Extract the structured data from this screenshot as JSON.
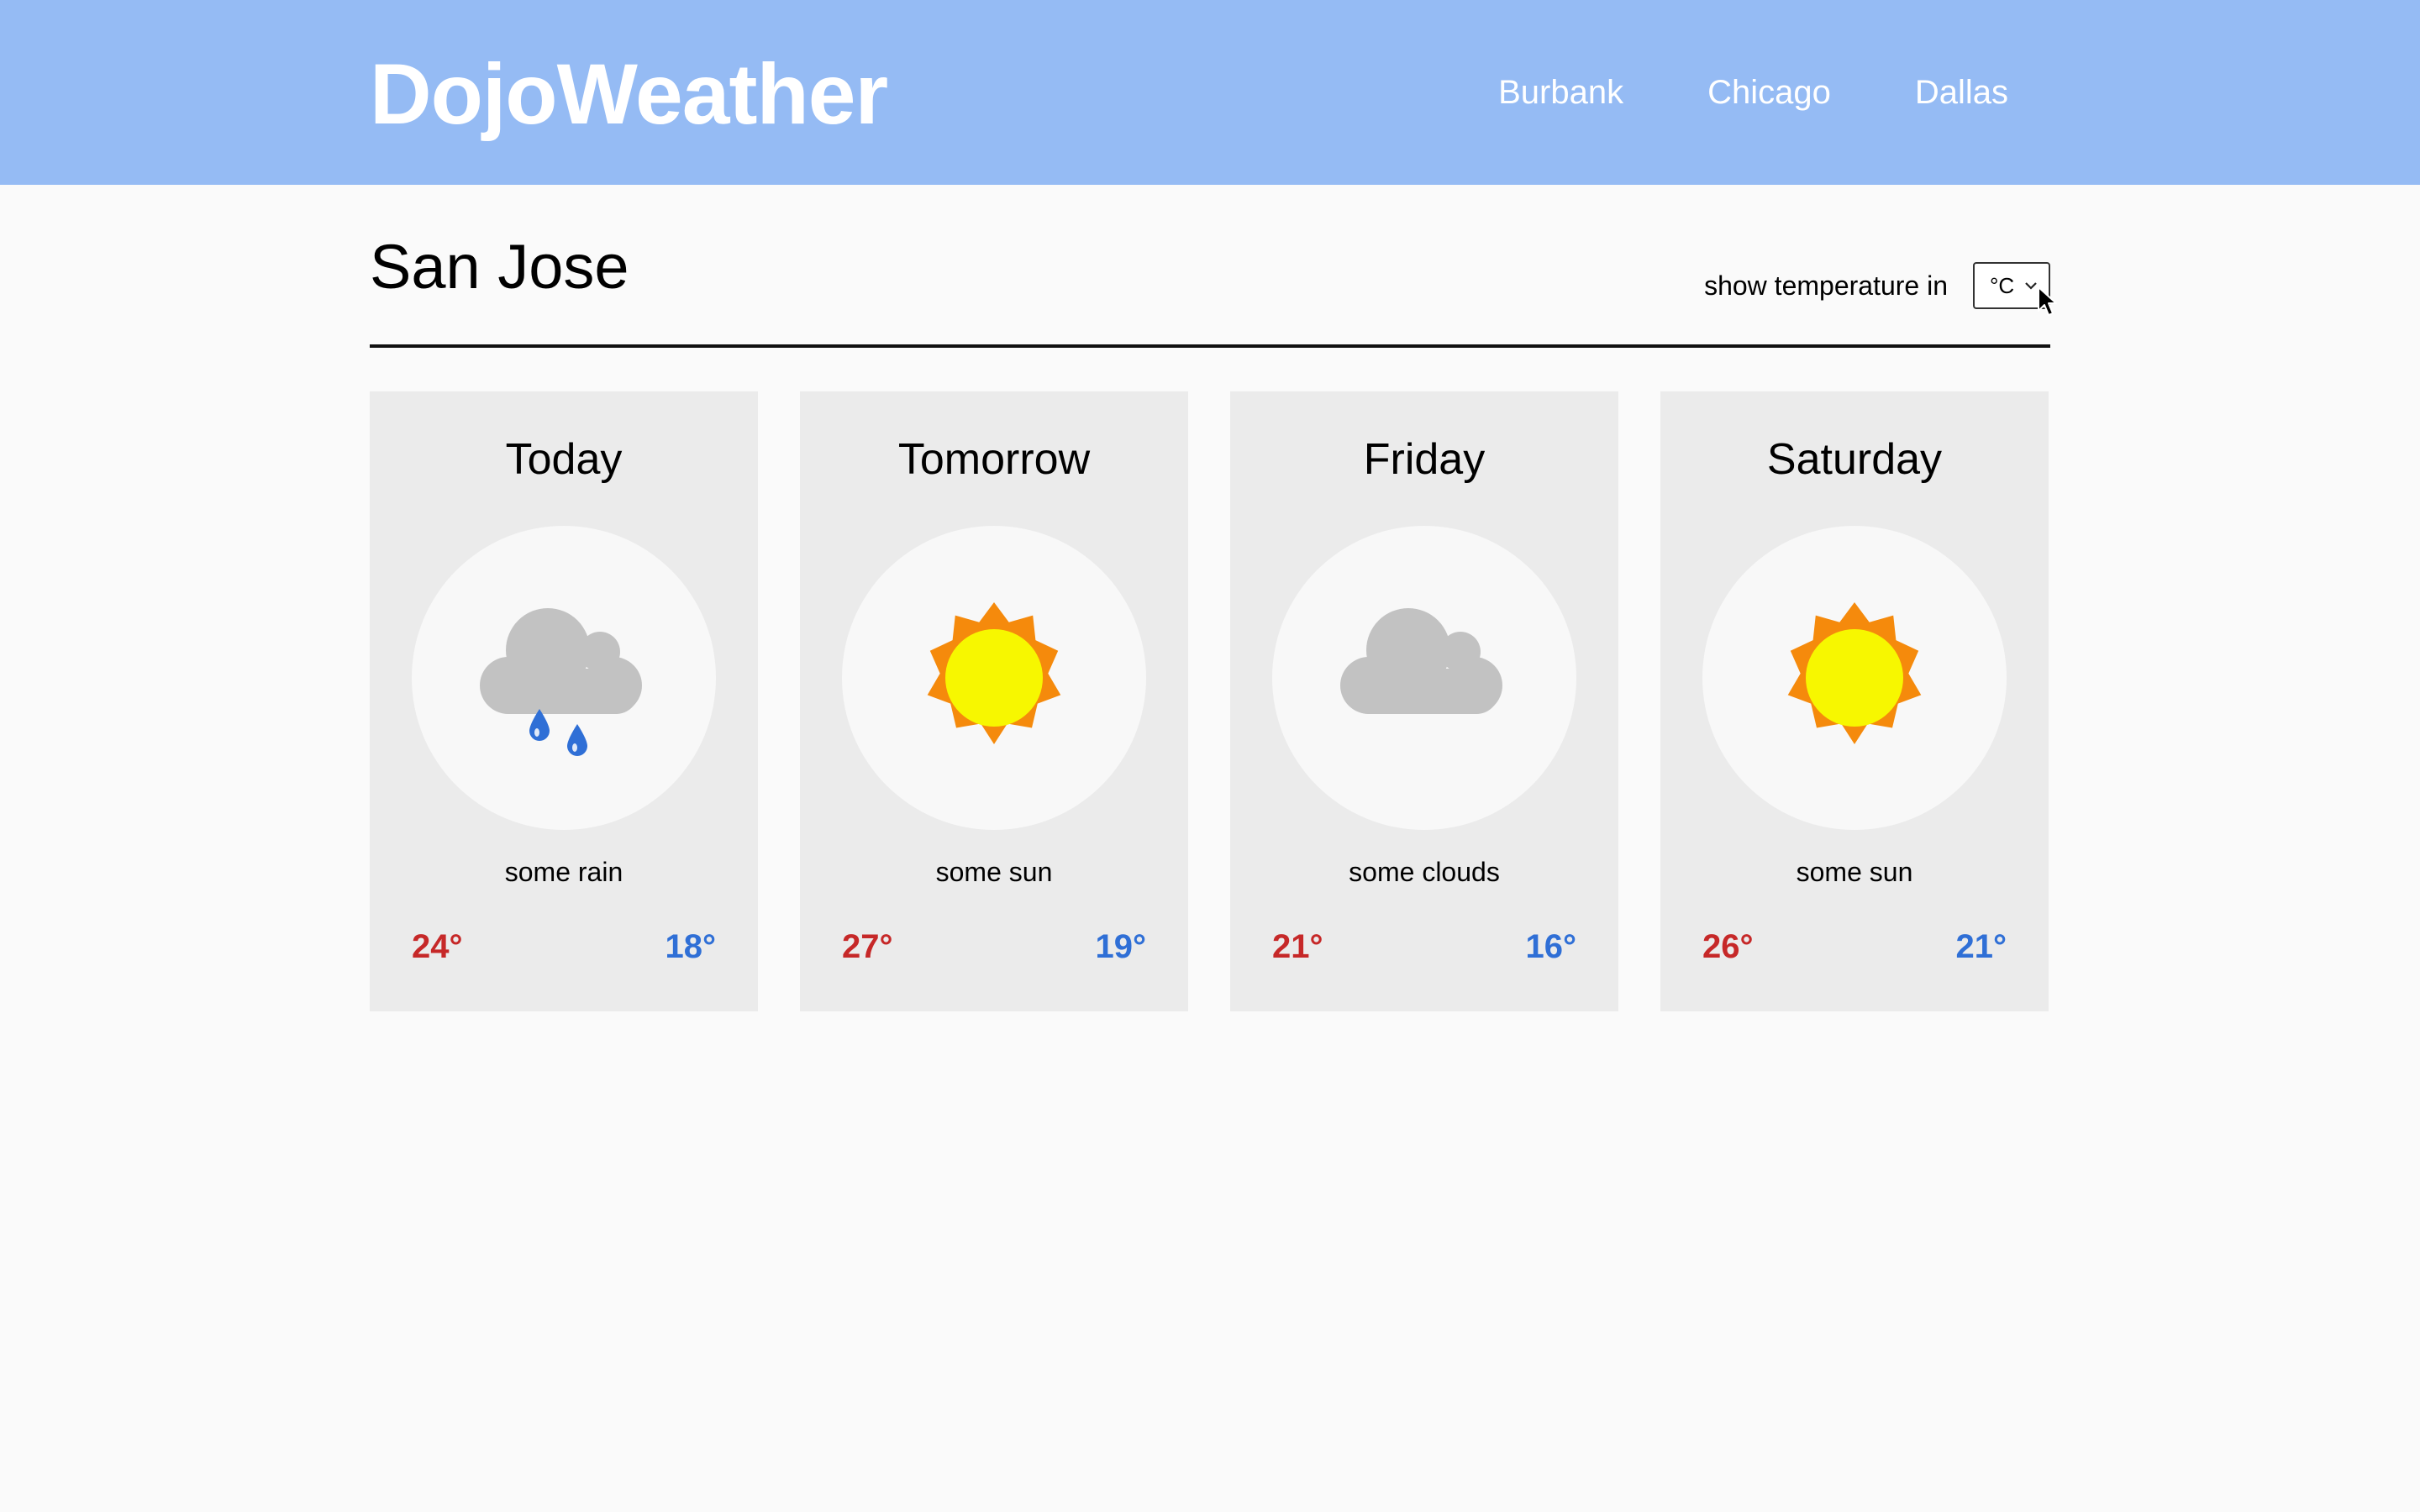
{
  "header": {
    "logo": "DojoWeather",
    "nav": [
      "Burbank",
      "Chicago",
      "Dallas"
    ],
    "background_color": "#95bbf4"
  },
  "location": {
    "city": "San Jose"
  },
  "unit_control": {
    "label": "show temperature in",
    "selected": "°C"
  },
  "forecast": [
    {
      "day": "Today",
      "icon": "rain-cloud-icon",
      "description": "some rain",
      "high": "24°",
      "low": "18°"
    },
    {
      "day": "Tomorrow",
      "icon": "sun-icon",
      "description": "some sun",
      "high": "27°",
      "low": "19°"
    },
    {
      "day": "Friday",
      "icon": "cloud-icon",
      "description": "some clouds",
      "high": "21°",
      "low": "16°"
    },
    {
      "day": "Saturday",
      "icon": "sun-icon",
      "description": "some sun",
      "high": "26°",
      "low": "21°"
    }
  ],
  "colors": {
    "high_temp": "#c62828",
    "low_temp": "#2f6fd6",
    "sun_core": "#f7f700",
    "sun_rays": "#f58a0c",
    "cloud": "#c2c2c2",
    "rain_drop": "#2f6fd6"
  }
}
